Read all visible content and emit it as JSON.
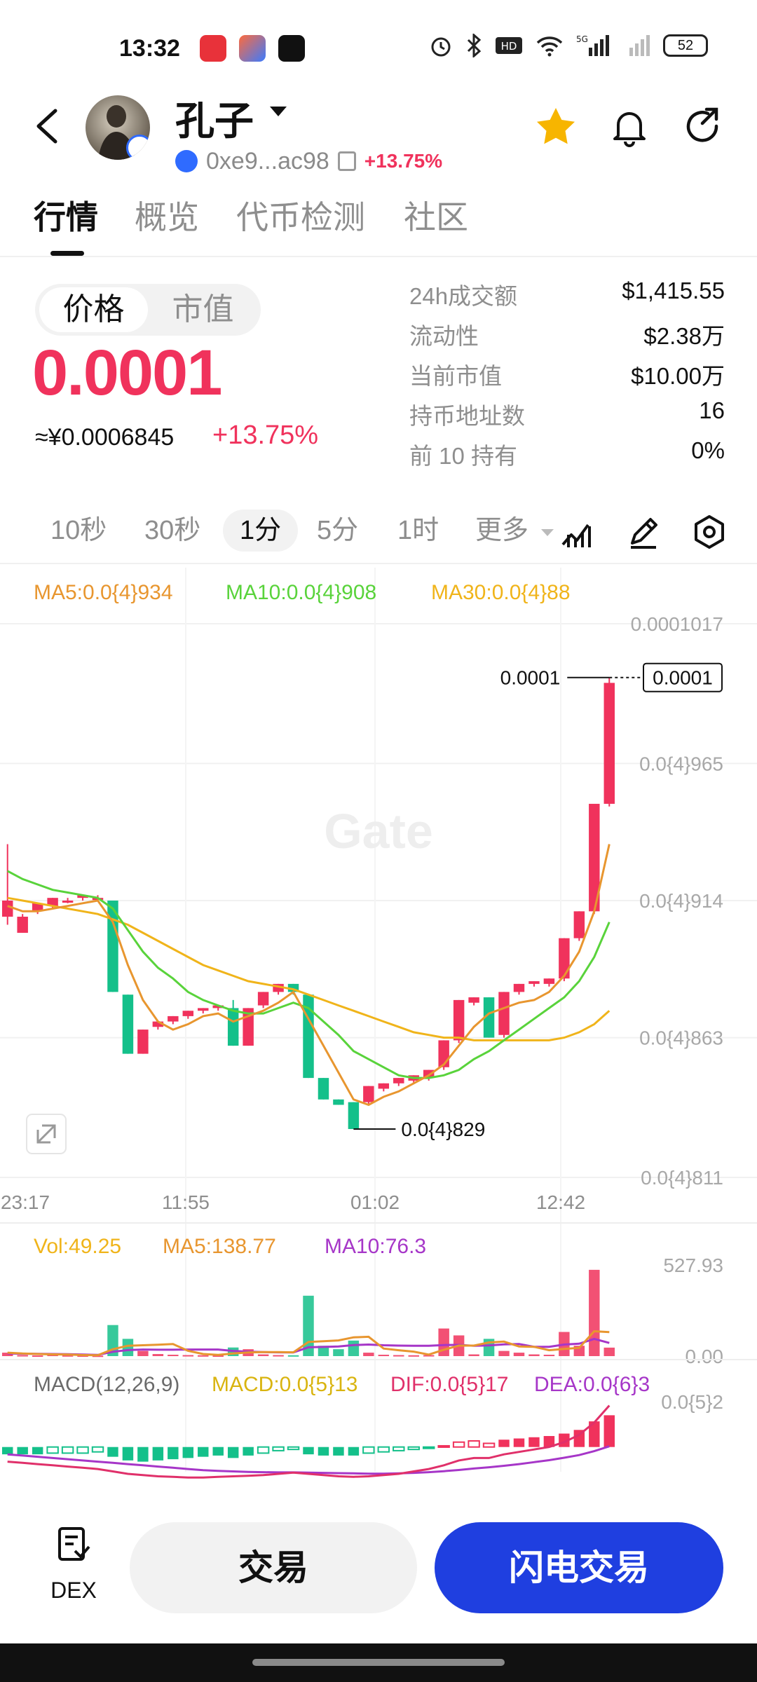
{
  "status": {
    "time": "13:32",
    "battery": "52"
  },
  "header": {
    "token_name": "孔子",
    "address": "0xe9...ac98",
    "change": "+13.75%"
  },
  "tabs": [
    {
      "label": "行情"
    },
    {
      "label": "概览"
    },
    {
      "label": "代币检测"
    },
    {
      "label": "社区"
    }
  ],
  "price_panel": {
    "toggle_price": "价格",
    "toggle_mcap": "市值",
    "price": "0.0001",
    "price_cny": "≈¥0.0006845",
    "change": "+13.75%"
  },
  "stats": [
    {
      "label": "24h成交额",
      "value": "$1,415.55"
    },
    {
      "label": "流动性",
      "value": "$2.38万"
    },
    {
      "label": "当前市值",
      "value": "$10.00万"
    },
    {
      "label": "持币地址数",
      "value": "16"
    },
    {
      "label": "前 10 持有",
      "value": "0%"
    }
  ],
  "intervals": [
    {
      "label": "10秒"
    },
    {
      "label": "30秒"
    },
    {
      "label": "1分"
    },
    {
      "label": "5分"
    },
    {
      "label": "1时"
    },
    {
      "label": "更多"
    }
  ],
  "colors": {
    "up": "#f0325c",
    "down": "#14c08a",
    "ma5": "#e8962f",
    "ma10": "#59d33b",
    "ma30": "#f0b41a",
    "macd": "#d9b410",
    "dif": "#e0306a",
    "dea": "#a636c8",
    "brand_blue": "#1f3fe0"
  },
  "chart_data": {
    "type": "candlestick",
    "ma_legend": {
      "ma5": "MA5:0.0{4}934",
      "ma10": "MA10:0.0{4}908",
      "ma30": "MA30:0.0{4}88"
    },
    "y_axis_labels": [
      "0.0001017",
      "0.0{4}965",
      "0.0{4}914",
      "0.0{4}863",
      "0.0{4}811"
    ],
    "y_range": [
      8.11e-05,
      0.0001017
    ],
    "x_axis_labels": [
      "23:17",
      "11:55",
      "01:02",
      "12:42"
    ],
    "last_price_label": "0.0001",
    "last_price_tag": "0.0001",
    "low_label": "0.0{4}829",
    "watermark": "Gate",
    "candles": [
      {
        "o": 9.08e-05,
        "c": 9.14e-05,
        "h": 9.35e-05,
        "l": 9.05e-05
      },
      {
        "o": 9.02e-05,
        "c": 9.08e-05,
        "h": 9.09e-05,
        "l": 9.02e-05
      },
      {
        "o": 9.1e-05,
        "c": 9.13e-05,
        "h": 9.13e-05,
        "l": 9.09e-05
      },
      {
        "o": 9.12e-05,
        "c": 9.15e-05,
        "h": 9.15e-05,
        "l": 9.11e-05
      },
      {
        "o": 9.14e-05,
        "c": 9.14e-05,
        "h": 9.15e-05,
        "l": 9.13e-05
      },
      {
        "o": 9.15e-05,
        "c": 9.16e-05,
        "h": 9.16e-05,
        "l": 9.14e-05
      },
      {
        "o": 9.15e-05,
        "c": 9.15e-05,
        "h": 9.16e-05,
        "l": 9.15e-05
      },
      {
        "o": 9.14e-05,
        "c": 8.8e-05,
        "h": 9.14e-05,
        "l": 8.8e-05
      },
      {
        "o": 8.79e-05,
        "c": 8.57e-05,
        "h": 8.79e-05,
        "l": 8.57e-05
      },
      {
        "o": 8.57e-05,
        "c": 8.66e-05,
        "h": 8.66e-05,
        "l": 8.57e-05
      },
      {
        "o": 8.67e-05,
        "c": 8.69e-05,
        "h": 8.69e-05,
        "l": 8.66e-05
      },
      {
        "o": 8.69e-05,
        "c": 8.71e-05,
        "h": 8.71e-05,
        "l": 8.68e-05
      },
      {
        "o": 8.71e-05,
        "c": 8.73e-05,
        "h": 8.73e-05,
        "l": 8.7e-05
      },
      {
        "o": 8.73e-05,
        "c": 8.74e-05,
        "h": 8.74e-05,
        "l": 8.72e-05
      },
      {
        "o": 8.74e-05,
        "c": 8.75e-05,
        "h": 8.75e-05,
        "l": 8.73e-05
      },
      {
        "o": 8.74e-05,
        "c": 8.6e-05,
        "h": 8.77e-05,
        "l": 8.6e-05
      },
      {
        "o": 8.6e-05,
        "c": 8.74e-05,
        "h": 8.74e-05,
        "l": 8.6e-05
      },
      {
        "o": 8.75e-05,
        "c": 8.8e-05,
        "h": 8.8e-05,
        "l": 8.74e-05
      },
      {
        "o": 8.8e-05,
        "c": 8.83e-05,
        "h": 8.83e-05,
        "l": 8.79e-05
      },
      {
        "o": 8.83e-05,
        "c": 8.8e-05,
        "h": 8.83e-05,
        "l": 8.79e-05
      },
      {
        "o": 8.79e-05,
        "c": 8.48e-05,
        "h": 8.79e-05,
        "l": 8.48e-05
      },
      {
        "o": 8.48e-05,
        "c": 8.4e-05,
        "h": 8.48e-05,
        "l": 8.4e-05
      },
      {
        "o": 8.4e-05,
        "c": 8.38e-05,
        "h": 8.4e-05,
        "l": 8.38e-05
      },
      {
        "o": 8.39e-05,
        "c": 8.29e-05,
        "h": 8.39e-05,
        "l": 8.29e-05
      },
      {
        "o": 8.39e-05,
        "c": 8.45e-05,
        "h": 8.45e-05,
        "l": 8.38e-05
      },
      {
        "o": 8.44e-05,
        "c": 8.46e-05,
        "h": 8.46e-05,
        "l": 8.43e-05
      },
      {
        "o": 8.46e-05,
        "c": 8.48e-05,
        "h": 8.48e-05,
        "l": 8.45e-05
      },
      {
        "o": 8.47e-05,
        "c": 8.49e-05,
        "h": 8.49e-05,
        "l": 8.46e-05
      },
      {
        "o": 8.48e-05,
        "c": 8.51e-05,
        "h": 8.51e-05,
        "l": 8.47e-05
      },
      {
        "o": 8.52e-05,
        "c": 8.62e-05,
        "h": 8.62e-05,
        "l": 8.51e-05
      },
      {
        "o": 8.62e-05,
        "c": 8.77e-05,
        "h": 8.77e-05,
        "l": 8.61e-05
      },
      {
        "o": 8.76e-05,
        "c": 8.78e-05,
        "h": 8.78e-05,
        "l": 8.75e-05
      },
      {
        "o": 8.78e-05,
        "c": 8.63e-05,
        "h": 8.78e-05,
        "l": 8.63e-05
      },
      {
        "o": 8.64e-05,
        "c": 8.8e-05,
        "h": 8.8e-05,
        "l": 8.63e-05
      },
      {
        "o": 8.8e-05,
        "c": 8.83e-05,
        "h": 8.83e-05,
        "l": 8.79e-05
      },
      {
        "o": 8.83e-05,
        "c": 8.84e-05,
        "h": 8.84e-05,
        "l": 8.82e-05
      },
      {
        "o": 8.83e-05,
        "c": 8.85e-05,
        "h": 8.85e-05,
        "l": 8.82e-05
      },
      {
        "o": 8.85e-05,
        "c": 9e-05,
        "h": 9e-05,
        "l": 8.84e-05
      },
      {
        "o": 9e-05,
        "c": 9.1e-05,
        "h": 9.1e-05,
        "l": 8.99e-05
      },
      {
        "o": 9.1e-05,
        "c": 9.5e-05,
        "h": 9.5e-05,
        "l": 9.09e-05
      },
      {
        "o": 9.5e-05,
        "c": 9.95e-05,
        "h": 9.97e-05,
        "l": 9.49e-05
      }
    ],
    "ma5": [
      9.12e-05,
      9.1e-05,
      9.1e-05,
      9.11e-05,
      9.12e-05,
      9.13e-05,
      9.14e-05,
      9.06e-05,
      8.9e-05,
      8.77e-05,
      8.69e-05,
      8.66e-05,
      8.68e-05,
      8.71e-05,
      8.72e-05,
      8.69e-05,
      8.71e-05,
      8.73e-05,
      8.76e-05,
      8.8e-05,
      8.7e-05,
      8.6e-05,
      8.5e-05,
      8.4e-05,
      8.38e-05,
      8.41e-05,
      8.43e-05,
      8.46e-05,
      8.49e-05,
      8.53e-05,
      8.6e-05,
      8.67e-05,
      8.72e-05,
      8.74e-05,
      8.76e-05,
      8.77e-05,
      8.8e-05,
      8.86e-05,
      8.95e-05,
      9.1e-05,
      9.35e-05
    ],
    "ma10": [
      9.25e-05,
      9.22e-05,
      9.2e-05,
      9.18e-05,
      9.17e-05,
      9.16e-05,
      9.15e-05,
      9.11e-05,
      9.03e-05,
      8.95e-05,
      8.89e-05,
      8.85e-05,
      8.8e-05,
      8.77e-05,
      8.75e-05,
      8.73e-05,
      8.72e-05,
      8.72e-05,
      8.74e-05,
      8.76e-05,
      8.74e-05,
      8.69e-05,
      8.64e-05,
      8.58e-05,
      8.55e-05,
      8.52e-05,
      8.49e-05,
      8.48e-05,
      8.48e-05,
      8.49e-05,
      8.51e-05,
      8.55e-05,
      8.58e-05,
      8.62e-05,
      8.66e-05,
      8.7e-05,
      8.74e-05,
      8.78e-05,
      8.84e-05,
      8.93e-05,
      9.06e-05
    ],
    "ma30": [
      9.15e-05,
      9.14e-05,
      9.13e-05,
      9.12e-05,
      9.11e-05,
      9.1e-05,
      9.09e-05,
      9.07e-05,
      9.05e-05,
      9.02e-05,
      8.99e-05,
      8.96e-05,
      8.93e-05,
      8.9e-05,
      8.88e-05,
      8.86e-05,
      8.84e-05,
      8.83e-05,
      8.82e-05,
      8.81e-05,
      8.79e-05,
      8.77e-05,
      8.75e-05,
      8.73e-05,
      8.71e-05,
      8.69e-05,
      8.67e-05,
      8.65e-05,
      8.64e-05,
      8.63e-05,
      8.63e-05,
      8.62e-05,
      8.62e-05,
      8.62e-05,
      8.62e-05,
      8.62e-05,
      8.62e-05,
      8.63e-05,
      8.65e-05,
      8.68e-05,
      8.73e-05
    ],
    "volume": {
      "legend": {
        "vol": "Vol:49.25",
        "ma5": "MA5:138.77",
        "ma10": "MA10:76.3"
      },
      "y_axis_labels": [
        "527.93",
        "0.00"
      ],
      "y_range": [
        0,
        527.93
      ],
      "values": [
        20,
        6,
        4,
        8,
        5,
        4,
        3,
        180,
        100,
        30,
        12,
        8,
        6,
        5,
        4,
        50,
        40,
        10,
        6,
        5,
        350,
        60,
        40,
        90,
        20,
        8,
        6,
        5,
        6,
        160,
        120,
        10,
        100,
        30,
        20,
        10,
        8,
        140,
        60,
        500,
        49.25
      ],
      "ma5": [
        20,
        15,
        12,
        10,
        9,
        6,
        5,
        40,
        60,
        63,
        66,
        70,
        31,
        12,
        7,
        15,
        21,
        23,
        23,
        22,
        82,
        86,
        91,
        109,
        112,
        44,
        34,
        26,
        9,
        37,
        61,
        61,
        79,
        84,
        56,
        54,
        34,
        42,
        48,
        144,
        138.77
      ],
      "ma10": [
        15,
        14,
        13,
        12,
        11,
        9,
        7,
        25,
        35,
        38,
        37,
        37,
        38,
        38,
        38,
        30,
        26,
        23,
        22,
        21,
        51,
        53,
        56,
        64,
        67,
        63,
        61,
        60,
        60,
        64,
        65,
        60,
        62,
        68,
        70,
        54,
        54,
        67,
        72,
        100,
        76.3
      ]
    },
    "macd": {
      "legend": {
        "title": "MACD(12,26,9)",
        "macd": "MACD:0.0{5}13",
        "dif": "DIF:0.0{5}17",
        "dea": "DEA:0.0{6}3"
      },
      "y_axis_labels": [
        "0.0{5}2"
      ],
      "hist": [
        -0.3,
        -0.3,
        -0.3,
        -0.25,
        -0.25,
        -0.25,
        -0.2,
        -0.4,
        -0.55,
        -0.6,
        -0.55,
        -0.5,
        -0.45,
        -0.4,
        -0.35,
        -0.45,
        -0.35,
        -0.25,
        -0.15,
        -0.1,
        -0.3,
        -0.35,
        -0.35,
        -0.35,
        -0.25,
        -0.2,
        -0.15,
        -0.1,
        -0.05,
        0.05,
        0.2,
        0.25,
        0.15,
        0.3,
        0.35,
        0.4,
        0.45,
        0.55,
        0.7,
        1.05,
        1.3
      ],
      "dif": [
        -0.6,
        -0.65,
        -0.7,
        -0.75,
        -0.8,
        -0.85,
        -0.9,
        -1.0,
        -1.1,
        -1.15,
        -1.2,
        -1.22,
        -1.25,
        -1.25,
        -1.22,
        -1.2,
        -1.18,
        -1.15,
        -1.1,
        -1.05,
        -1.1,
        -1.15,
        -1.2,
        -1.22,
        -1.2,
        -1.15,
        -1.1,
        -1.0,
        -0.9,
        -0.75,
        -0.55,
        -0.45,
        -0.45,
        -0.3,
        -0.2,
        -0.1,
        0.0,
        0.2,
        0.5,
        1.0,
        1.7
      ],
      "dea": [
        -0.3,
        -0.35,
        -0.4,
        -0.45,
        -0.5,
        -0.55,
        -0.6,
        -0.65,
        -0.7,
        -0.75,
        -0.8,
        -0.85,
        -0.9,
        -0.95,
        -0.98,
        -1.0,
        -1.02,
        -1.03,
        -1.04,
        -1.04,
        -1.05,
        -1.06,
        -1.07,
        -1.08,
        -1.09,
        -1.09,
        -1.08,
        -1.06,
        -1.03,
        -0.99,
        -0.94,
        -0.88,
        -0.83,
        -0.77,
        -0.7,
        -0.62,
        -0.54,
        -0.44,
        -0.33,
        -0.17,
        0.03
      ],
      "range": [
        -1.3,
        2.0
      ]
    }
  },
  "bottom": {
    "dex_label": "DEX",
    "trade_label": "交易",
    "flash_trade_label": "闪电交易"
  }
}
